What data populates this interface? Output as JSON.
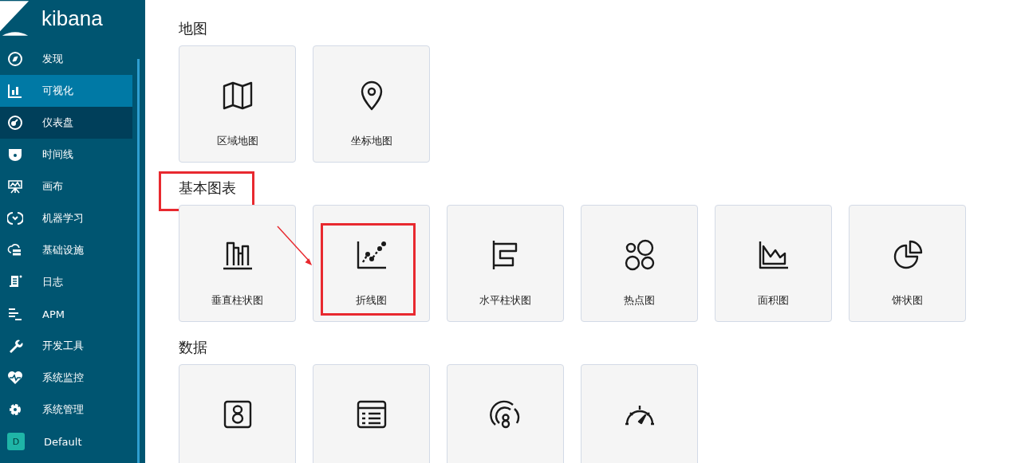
{
  "sidebar": {
    "logo": "kibana",
    "items": [
      {
        "kind": "compass",
        "label": "发现",
        "selected": false,
        "hovered": false
      },
      {
        "kind": "bars",
        "label": "可视化",
        "selected": true,
        "hovered": false
      },
      {
        "kind": "dashboard",
        "label": "仪表盘",
        "selected": false,
        "hovered": true
      },
      {
        "kind": "timeline",
        "label": "时间线",
        "selected": false,
        "hovered": false
      },
      {
        "kind": "canvas",
        "label": "画布",
        "selected": false,
        "hovered": false
      },
      {
        "kind": "ml",
        "label": "机器学习",
        "selected": false,
        "hovered": false
      },
      {
        "kind": "infra",
        "label": "基础设施",
        "selected": false,
        "hovered": false
      },
      {
        "kind": "logs",
        "label": "日志",
        "selected": false,
        "hovered": false
      },
      {
        "kind": "apm",
        "label": "APM",
        "selected": false,
        "hovered": false
      },
      {
        "kind": "wrench",
        "label": "开发工具",
        "selected": false,
        "hovered": false
      },
      {
        "kind": "heart",
        "label": "系统监控",
        "selected": false,
        "hovered": false
      },
      {
        "kind": "gear",
        "label": "系统管理",
        "selected": false,
        "hovered": false
      },
      {
        "kind": "space",
        "avatar": "D",
        "label": "Default",
        "selected": false,
        "hovered": false
      }
    ]
  },
  "sections": [
    {
      "title": "地图",
      "highlighted": false,
      "tiles": [
        {
          "kind": "map",
          "label": "区域地图",
          "highlighted": false
        },
        {
          "kind": "pin",
          "label": "坐标地图",
          "highlighted": false
        }
      ]
    },
    {
      "title": "基本图表",
      "highlighted": true,
      "tiles": [
        {
          "kind": "vbar",
          "label": "垂直柱状图",
          "highlighted": false
        },
        {
          "kind": "line",
          "label": "折线图",
          "highlighted": true
        },
        {
          "kind": "hbar",
          "label": "水平柱状图",
          "highlighted": false
        },
        {
          "kind": "bubbles",
          "label": "热点图",
          "highlighted": false
        },
        {
          "kind": "area",
          "label": "面积图",
          "highlighted": false
        },
        {
          "kind": "pie",
          "label": "饼状图",
          "highlighted": false
        }
      ]
    },
    {
      "title": "数据",
      "highlighted": false,
      "tiles": [
        {
          "kind": "metric"
        },
        {
          "kind": "table"
        },
        {
          "kind": "goal"
        },
        {
          "kind": "gauge"
        }
      ]
    }
  ]
}
